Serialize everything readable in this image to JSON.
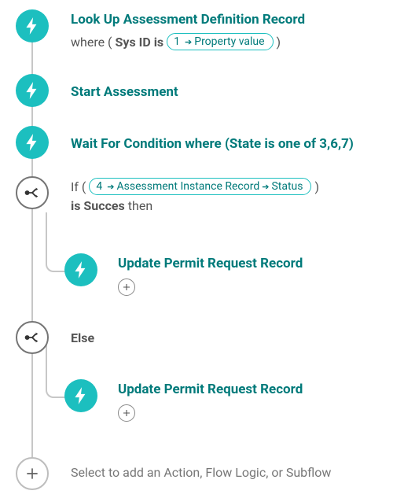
{
  "colors": {
    "accent": "#1cbfbf",
    "accentDark": "#007a7a"
  },
  "steps": {
    "lookup": {
      "title": "Look Up Assessment Definition Record",
      "desc_prefix": "where (",
      "desc_field": "Sys ID is",
      "pill_num": "1",
      "pill_label": "Property value",
      "desc_suffix": ")"
    },
    "start": {
      "title": "Start Assessment"
    },
    "wait": {
      "title": "Wait For Condition where (State is one of 3,6,7)"
    },
    "ifblock": {
      "prefix": "If",
      "pill_num": "4",
      "pill_seg1": "Assessment Instance Record",
      "pill_seg2": "Status",
      "mid": "is Succes",
      "suffix": "then"
    },
    "update1": {
      "title": "Update Permit Request Record"
    },
    "elseblock": {
      "label": "Else"
    },
    "update2": {
      "title": "Update Permit Request Record"
    },
    "add": {
      "placeholder": "Select to add an Action, Flow Logic, or Subflow"
    }
  }
}
